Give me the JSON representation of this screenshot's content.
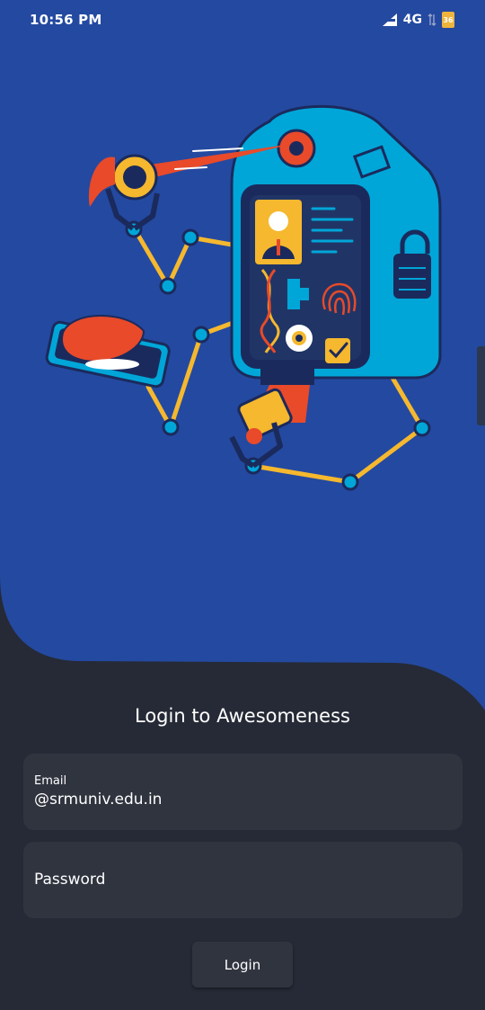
{
  "status_bar": {
    "time": "10:56 PM",
    "network": "4G",
    "battery": "36"
  },
  "colors": {
    "hero_blue": "#2449a0",
    "panel_dark": "#252a36",
    "field_bg": "#30343f",
    "robot_cyan": "#00a6d8",
    "accent_yellow": "#f5b82e",
    "accent_red": "#e84a2a"
  },
  "illustration": {
    "icon": "security-robot-illustration"
  },
  "login": {
    "title": "Login to Awesomeness",
    "email_label": "Email",
    "email_value": "@srmuniv.edu.in",
    "password_placeholder": "Password",
    "button_label": "Login"
  }
}
